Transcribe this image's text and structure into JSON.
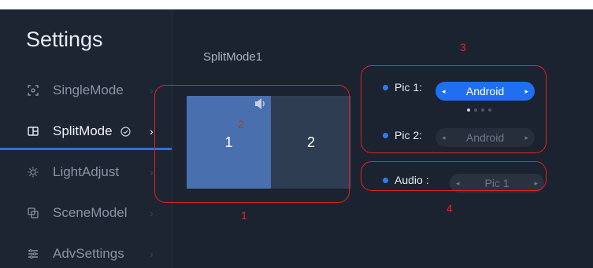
{
  "sidebar": {
    "title": "Settings",
    "items": [
      {
        "label": "SingleMode",
        "icon": "single-mode-icon"
      },
      {
        "label": "SplitMode",
        "icon": "split-mode-icon"
      },
      {
        "label": "LightAdjust",
        "icon": "brightness-icon"
      },
      {
        "label": "SceneModel",
        "icon": "scene-model-icon"
      },
      {
        "label": "AdvSettings",
        "icon": "adv-settings-icon"
      }
    ],
    "active_item": "SplitMode"
  },
  "main": {
    "split_label": "SplitMode1",
    "pane1_label": "1",
    "pane2_label": "2",
    "pic1": {
      "label": "Pic 1:",
      "value": "Android"
    },
    "pic2": {
      "label": "Pic 2:",
      "value": "Android"
    },
    "audio": {
      "label": "Audio :",
      "value": "Pic 1"
    },
    "pager": {
      "count": 4,
      "active_index": 0
    }
  },
  "annotations": {
    "n1": "1",
    "n2": "2",
    "n3": "3",
    "n4": "4"
  },
  "colors": {
    "background": "#1b2230",
    "accent": "#1f6ff0",
    "annotation": "#e02424"
  }
}
